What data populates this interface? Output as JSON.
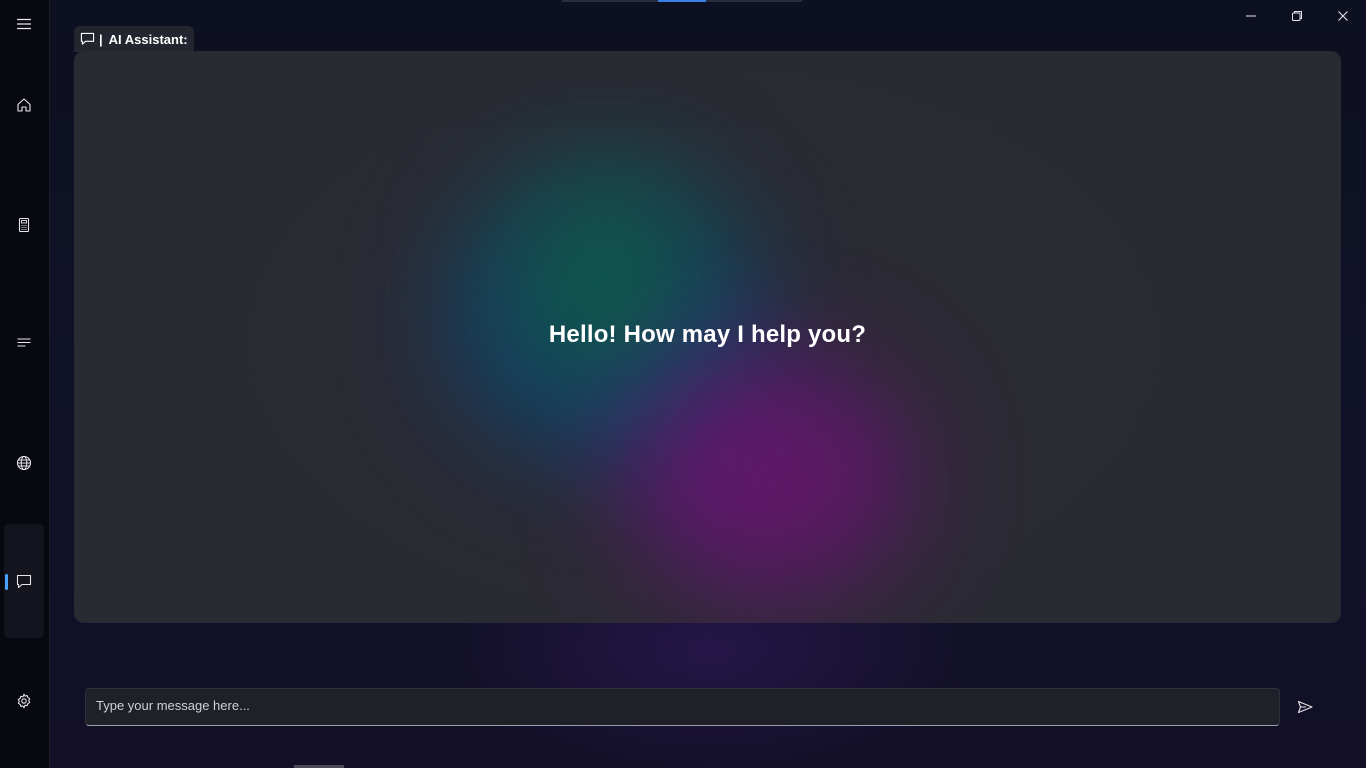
{
  "window": {
    "title": "AI Assistant:",
    "controls": {
      "minimize_icon": "minimize-icon",
      "maximize_icon": "restore-icon",
      "close_icon": "close-icon"
    }
  },
  "sidebar": {
    "items": [
      {
        "id": "menu",
        "icon": "hamburger-menu-icon"
      },
      {
        "id": "home",
        "icon": "home-icon"
      },
      {
        "id": "calculator",
        "icon": "calculator-icon"
      },
      {
        "id": "notes",
        "icon": "text-lines-icon"
      },
      {
        "id": "web",
        "icon": "globe-icon"
      },
      {
        "id": "chat",
        "icon": "chat-icon",
        "active": true
      },
      {
        "id": "settings",
        "icon": "gear-icon"
      }
    ],
    "accent_color": "#4aa3ff"
  },
  "tab": {
    "separator": "|",
    "label": "AI Assistant:",
    "icon": "chat-icon"
  },
  "chat": {
    "greeting": "Hello! How may I help you?"
  },
  "composer": {
    "value": "",
    "placeholder": "Type your message here...",
    "send_icon": "send-icon"
  },
  "colors": {
    "background": "#0b0d18",
    "card": "#2b2b33",
    "text": "#ffffff"
  }
}
